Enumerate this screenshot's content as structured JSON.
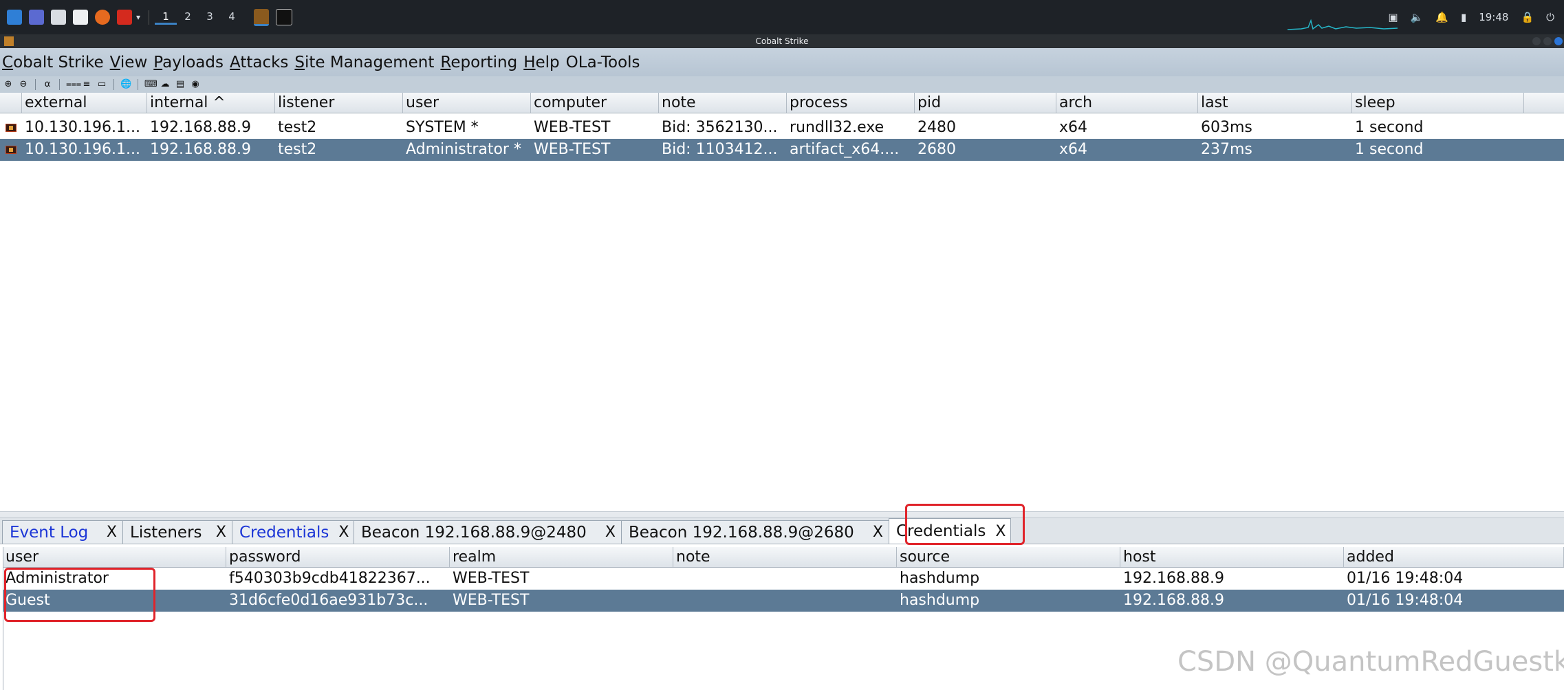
{
  "system_panel": {
    "workspaces": [
      "1",
      "2",
      "3",
      "4"
    ],
    "active_workspace": "1",
    "clock": "19:48"
  },
  "window": {
    "title": "Cobalt Strike"
  },
  "menu": {
    "items": [
      {
        "label": "Cobalt Strike",
        "u": "C"
      },
      {
        "label": "View",
        "u": "V"
      },
      {
        "label": "Payloads",
        "u": "P"
      },
      {
        "label": "Attacks",
        "u": "A"
      },
      {
        "label": "Site Management",
        "u": "S"
      },
      {
        "label": "Reporting",
        "u": "R"
      },
      {
        "label": "Help",
        "u": "H"
      },
      {
        "label": "OLa-Tools",
        "u": ""
      }
    ]
  },
  "toolbar": {
    "icons": [
      "add-icon",
      "remove-icon",
      "headphones-icon",
      "share-icon",
      "list-icon",
      "laptop-icon",
      "globe-icon",
      "keyboard-icon",
      "cloud-icon",
      "terminal-icon",
      "camera-icon"
    ]
  },
  "beacons": {
    "columns": [
      "external",
      "internal ^",
      "listener",
      "user",
      "computer",
      "note",
      "process",
      "pid",
      "arch",
      "last",
      "sleep"
    ],
    "rows": [
      {
        "external": "10.130.196.1...",
        "internal": "192.168.88.9",
        "listener": "test2",
        "user": "SYSTEM *",
        "computer": "WEB-TEST",
        "note": "Bid: 3562130...",
        "process": "rundll32.exe",
        "pid": "2480",
        "arch": "x64",
        "last": "603ms",
        "sleep": " 1 second",
        "selected": false
      },
      {
        "external": "10.130.196.1...",
        "internal": "192.168.88.9",
        "listener": "test2",
        "user": "Administrator *",
        "computer": "WEB-TEST",
        "note": "Bid: 1103412...",
        "process": "artifact_x64....",
        "pid": "2680",
        "arch": "x64",
        "last": "237ms",
        "sleep": " 1 second",
        "selected": true
      }
    ]
  },
  "tabs": [
    {
      "label": "Event Log",
      "close": "X",
      "blue": true,
      "active": false
    },
    {
      "label": "Listeners",
      "close": "X",
      "blue": false,
      "active": false
    },
    {
      "label": "Credentials",
      "close": "X",
      "blue": true,
      "active": false
    },
    {
      "label": "Beacon 192.168.88.9@2480",
      "close": "X",
      "blue": false,
      "active": false
    },
    {
      "label": "Beacon 192.168.88.9@2680",
      "close": "X",
      "blue": false,
      "active": false
    },
    {
      "label": "Credentials",
      "close": "X",
      "blue": false,
      "active": true
    }
  ],
  "credentials": {
    "columns": [
      "user",
      "password",
      "realm",
      "note",
      "source",
      "host",
      "added"
    ],
    "rows": [
      {
        "user": "Administrator",
        "password": "f540303b9cdb41822367...",
        "realm": "WEB-TEST",
        "note": "",
        "source": "hashdump",
        "host": "192.168.88.9",
        "added": "01/16 19:48:04",
        "selected": false
      },
      {
        "user": "Guest",
        "password": "31d6cfe0d16ae931b73c...",
        "realm": "WEB-TEST",
        "note": "",
        "source": "hashdump",
        "host": "192.168.88.9",
        "added": "01/16 19:48:04",
        "selected": true
      }
    ]
  },
  "watermark": "CSDN @QuantumRedGuestk"
}
